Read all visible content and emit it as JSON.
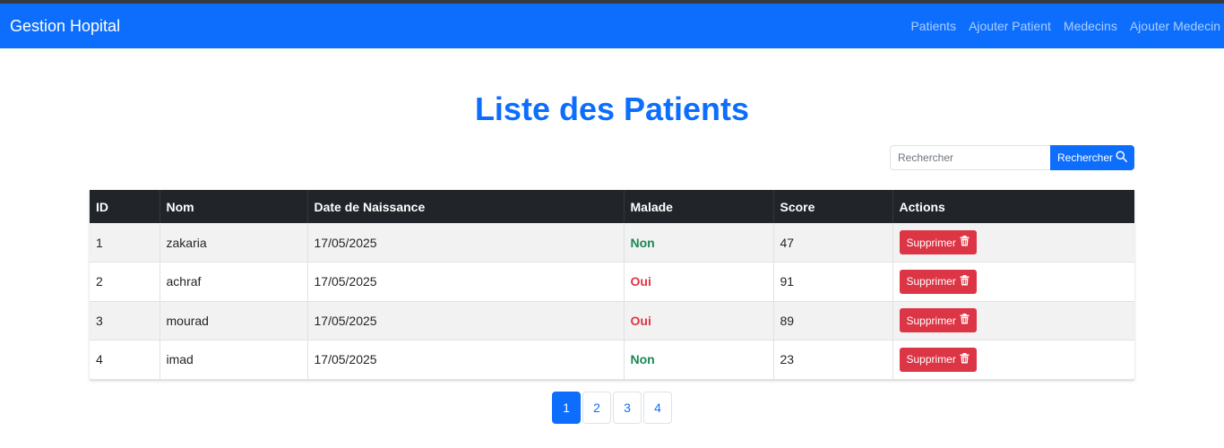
{
  "navbar": {
    "brand": "Gestion Hopital",
    "links": [
      "Patients",
      "Ajouter Patient",
      "Medecins",
      "Ajouter Medecin"
    ],
    "color": "#0d6efd"
  },
  "main": {
    "title": "Liste des Patients",
    "search": {
      "placeholder": "Rechercher",
      "value": "",
      "button_label": "Rechercher",
      "icon": "search-icon"
    }
  },
  "table": {
    "headers": [
      "ID",
      "Nom",
      "Date de Naissance",
      "Malade",
      "Score",
      "Actions"
    ],
    "rows": [
      {
        "id": "1",
        "nom": "zakaria",
        "date": "17/05/2025",
        "malade": "Non",
        "score": "47",
        "action": "Supprimer"
      },
      {
        "id": "2",
        "nom": "achraf",
        "date": "17/05/2025",
        "malade": "Oui",
        "score": "91",
        "action": "Supprimer"
      },
      {
        "id": "3",
        "nom": "mourad",
        "date": "17/05/2025",
        "malade": "Oui",
        "score": "89",
        "action": "Supprimer"
      },
      {
        "id": "4",
        "nom": "imad",
        "date": "17/05/2025",
        "malade": "Non",
        "score": "23",
        "action": "Supprimer"
      }
    ],
    "action_icon": "trash-icon",
    "status_colors": {
      "Non": "#198754",
      "Oui": "#dc3545"
    }
  },
  "pagination": {
    "pages": [
      "1",
      "2",
      "3",
      "4"
    ],
    "current": "1"
  }
}
